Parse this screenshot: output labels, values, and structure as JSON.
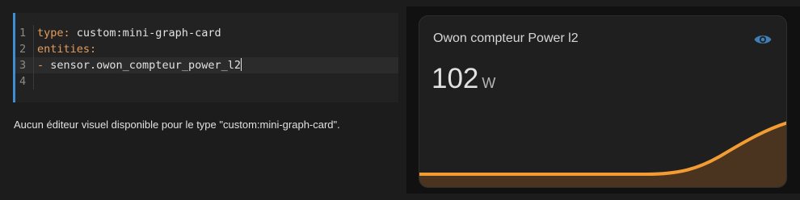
{
  "editor": {
    "lines": [
      {
        "num": "1",
        "key": "type:",
        "value": " custom:mini-graph-card"
      },
      {
        "num": "2",
        "key": "entities:",
        "value": ""
      },
      {
        "num": "3",
        "key": "-",
        "value": " sensor.owon_compteur_power_l2"
      },
      {
        "num": "4",
        "key": "",
        "value": ""
      }
    ]
  },
  "notice": "Aucun éditeur visuel disponible pour le type \"custom:mini-graph-card\".",
  "card": {
    "title": "Owon compteur Power l2",
    "value": "102",
    "unit": "W",
    "icon": "eye-icon",
    "accent_color": "#f39c33",
    "icon_color": "#3f7fb6"
  }
}
